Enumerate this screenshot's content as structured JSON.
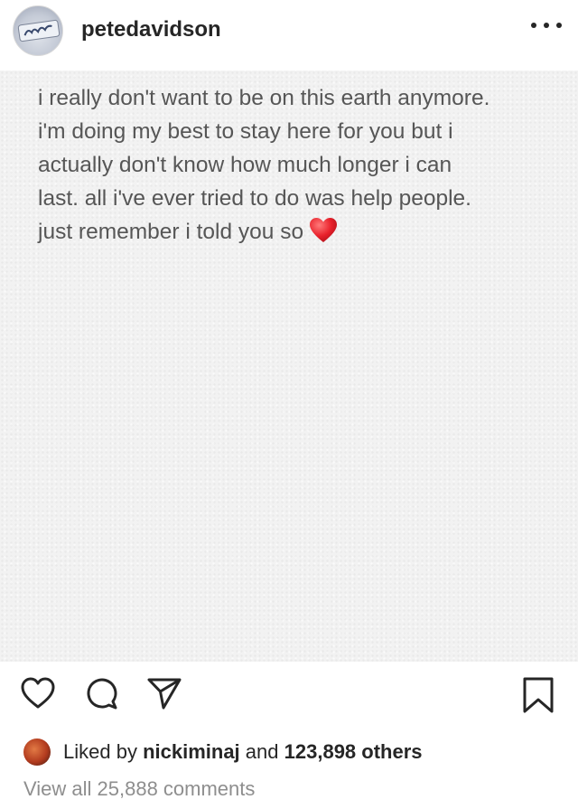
{
  "header": {
    "username": "petedavidson",
    "more_icon": "more-horizontal-icon"
  },
  "post": {
    "lines": [
      "i really don't want to be on this earth anymore.",
      "i'm doing my best to stay here for you but i",
      "actually don't know how much longer i can",
      "last. all i've ever tried to do was help people.",
      "just remember i told you so"
    ],
    "emoji": "red-heart-emoji"
  },
  "actions": {
    "icons": [
      "heart-icon",
      "comment-icon",
      "share-icon",
      "bookmark-icon"
    ]
  },
  "likes": {
    "prefix": "Liked by",
    "user": "nickiminaj",
    "conjunction": "and",
    "count_text": "123,898 others"
  },
  "comments": {
    "label": "View all 25,888 comments"
  }
}
